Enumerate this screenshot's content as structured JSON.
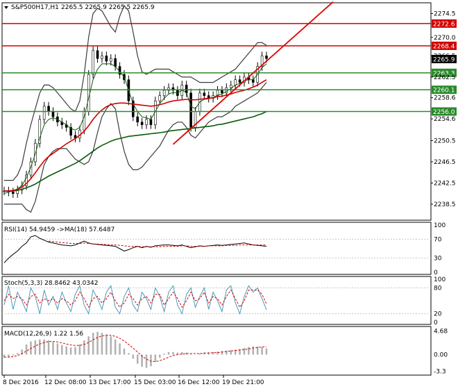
{
  "header": {
    "symbol": "S&P500H17,H1",
    "ohlc": "2265.5 2265.9 2265.5 2265.9"
  },
  "colors": {
    "bg": "#ffffff",
    "grid": "#c8c8c8",
    "candle": "#000000",
    "bollinger": "#3a3a3a",
    "ma_fast": "#0a5a0a",
    "ma_mid": "#d00000",
    "ma_slow": "#0a5a0a",
    "red_level": "#d00000",
    "green_level": "#2a8a2a",
    "trend": "#e00000",
    "rsi": "#000000",
    "rsi_ma": "#d00000",
    "stoch_main": "#4a9aba",
    "stoch_signal": "#d00000",
    "macd_hist": "#b0b0b0",
    "macd_signal": "#d00000"
  },
  "chart_data": [
    {
      "type": "line",
      "name": "price",
      "title": "S&P500H17,H1",
      "ylim": [
        2236.0,
        2276.0
      ],
      "y_ticks": [
        2274.5,
        2270.0,
        2266.5,
        2262.5,
        2258.6,
        2254.6,
        2250.5,
        2246.5,
        2242.5,
        2238.5
      ],
      "x_ticks": [
        "8 Dec 2016",
        "12 Dec 08:00",
        "13 Dec 17:00",
        "15 Dec 03:00",
        "16 Dec 12:00",
        "19 Dec 21:00"
      ],
      "current_price": 2265.9,
      "levels": [
        {
          "value": 2272.6,
          "label": "2272.6",
          "color": "red"
        },
        {
          "value": 2268.4,
          "label": "2268.4",
          "color": "red"
        },
        {
          "value": 2263.3,
          "label": "2263.3",
          "color": "green"
        },
        {
          "value": 2260.1,
          "label": "2260.1",
          "color": "green"
        },
        {
          "value": 2256.0,
          "label": "2256.0",
          "color": "green"
        }
      ],
      "close": [
        2241.0,
        2240.8,
        2240.5,
        2241.2,
        2242.0,
        2244.0,
        2246.5,
        2250.0,
        2254.5,
        2257.0,
        2256.0,
        2255.0,
        2254.0,
        2253.5,
        2253.0,
        2251.5,
        2251.0,
        2252.5,
        2256.0,
        2263.0,
        2267.5,
        2266.0,
        2266.5,
        2265.5,
        2266.0,
        2264.5,
        2263.0,
        2262.0,
        2258.0,
        2255.0,
        2254.0,
        2253.5,
        2254.5,
        2253.5,
        2258.0,
        2259.0,
        2260.0,
        2260.5,
        2260.0,
        2259.0,
        2261.0,
        2259.5,
        2253.0,
        2256.0,
        2259.5,
        2259.0,
        2258.5,
        2259.0,
        2260.0,
        2259.5,
        2260.5,
        2261.0,
        2262.0,
        2261.5,
        2262.5,
        2262.0,
        2261.5,
        2264.5,
        2266.5,
        2266.0
      ],
      "ma_fast": [
        2240.5,
        2240.8,
        2241.0,
        2241.4,
        2242.0,
        2243.5,
        2245.5,
        2248.0,
        2251.0,
        2253.5,
        2254.5,
        2254.8,
        2254.5,
        2254.0,
        2253.5,
        2252.8,
        2252.5,
        2253.0,
        2255.0,
        2258.5,
        2262.0,
        2264.0,
        2265.0,
        2265.0,
        2265.0,
        2264.5,
        2263.5,
        2262.5,
        2260.0,
        2257.5,
        2256.0,
        2255.0,
        2254.8,
        2254.5,
        2256.0,
        2257.5,
        2258.5,
        2259.3,
        2259.6,
        2259.5,
        2260.0,
        2259.6,
        2257.0,
        2256.5,
        2257.8,
        2258.3,
        2258.4,
        2258.6,
        2259.1,
        2259.3,
        2259.8,
        2260.3,
        2261.0,
        2261.3,
        2261.8,
        2262.0,
        2262.0,
        2263.0,
        2264.3,
        2265.0
      ],
      "ma_mid": [
        2241.0,
        2241.0,
        2241.1,
        2241.3,
        2241.7,
        2242.4,
        2243.3,
        2244.4,
        2245.6,
        2246.7,
        2247.5,
        2248.1,
        2248.7,
        2249.3,
        2249.9,
        2250.4,
        2250.9,
        2251.5,
        2252.3,
        2253.3,
        2254.5,
        2255.5,
        2256.3,
        2256.9,
        2257.3,
        2257.5,
        2257.6,
        2257.6,
        2257.5,
        2257.4,
        2257.3,
        2257.2,
        2257.1,
        2257.0,
        2257.1,
        2257.3,
        2257.5,
        2257.8,
        2258.0,
        2258.1,
        2258.2,
        2258.3,
        2258.2,
        2258.2,
        2258.3,
        2258.4,
        2258.5,
        2258.6,
        2258.8,
        2258.9,
        2259.1,
        2259.3,
        2259.6,
        2259.8,
        2260.0,
        2260.3,
        2260.6,
        2261.0,
        2261.5,
        2262.0
      ],
      "ma_slow": [
        2241.0,
        2241.0,
        2241.0,
        2241.1,
        2241.3,
        2241.6,
        2241.9,
        2242.3,
        2242.8,
        2243.3,
        2243.8,
        2244.2,
        2244.6,
        2245.0,
        2245.4,
        2245.8,
        2246.2,
        2246.7,
        2247.3,
        2247.9,
        2248.5,
        2249.1,
        2249.6,
        2250.0,
        2250.4,
        2250.7,
        2250.9,
        2251.1,
        2251.3,
        2251.4,
        2251.5,
        2251.6,
        2251.7,
        2251.8,
        2251.9,
        2252.0,
        2252.1,
        2252.3,
        2252.4,
        2252.5,
        2252.6,
        2252.7,
        2252.8,
        2252.9,
        2253.0,
        2253.1,
        2253.2,
        2253.3,
        2253.5,
        2253.6,
        2253.8,
        2254.0,
        2254.2,
        2254.4,
        2254.6,
        2254.8,
        2255.0,
        2255.3,
        2255.6,
        2256.0
      ],
      "boll_upper": [
        2243.0,
        2243.0,
        2243.0,
        2244.0,
        2246.0,
        2250.0,
        2253.5,
        2256.5,
        2259.5,
        2261.0,
        2261.0,
        2260.5,
        2259.5,
        2258.5,
        2257.5,
        2256.5,
        2256.0,
        2258.0,
        2263.0,
        2270.0,
        2274.5,
        2275.5,
        2275.0,
        2273.5,
        2272.0,
        2271.0,
        2274.0,
        2276.0,
        2275.0,
        2271.0,
        2266.5,
        2263.5,
        2263.0,
        2263.5,
        2264.0,
        2264.0,
        2264.0,
        2264.0,
        2263.5,
        2263.0,
        2262.5,
        2262.5,
        2262.5,
        2262.0,
        2261.5,
        2261.5,
        2261.5,
        2261.5,
        2262.0,
        2262.5,
        2263.0,
        2263.5,
        2264.0,
        2265.0,
        2266.0,
        2267.0,
        2268.0,
        2269.0,
        2269.0,
        2268.5
      ],
      "boll_lower": [
        2238.5,
        2238.5,
        2238.5,
        2238.5,
        2238.5,
        2237.5,
        2237.0,
        2239.0,
        2242.5,
        2246.0,
        2247.5,
        2248.5,
        2249.0,
        2249.0,
        2249.0,
        2248.0,
        2247.0,
        2246.5,
        2246.0,
        2246.5,
        2248.5,
        2252.0,
        2255.0,
        2256.5,
        2257.5,
        2256.5,
        2252.0,
        2248.5,
        2246.0,
        2245.0,
        2245.0,
        2245.5,
        2246.5,
        2247.5,
        2248.5,
        2249.5,
        2251.0,
        2252.5,
        2253.5,
        2254.0,
        2254.0,
        2253.0,
        2251.5,
        2251.0,
        2252.0,
        2253.0,
        2254.0,
        2254.5,
        2255.0,
        2255.0,
        2255.5,
        2256.0,
        2257.0,
        2257.5,
        2258.0,
        2258.5,
        2259.0,
        2259.5,
        2260.5,
        2261.5
      ],
      "trendline": {
        "from": [
          38,
          2249.8
        ],
        "to": [
          59,
          2265.5
        ]
      }
    },
    {
      "type": "line",
      "name": "rsi",
      "title": "RSI(14) 54.9459 ->MA(18) 57.6487",
      "ylim": [
        0,
        100
      ],
      "y_ticks": [
        100,
        70,
        30,
        0
      ],
      "values": [
        20,
        30,
        38,
        45,
        55,
        62,
        75,
        78,
        72,
        68,
        64,
        62,
        60,
        58,
        57,
        56,
        58,
        62,
        66,
        62,
        60,
        59,
        58,
        57,
        56,
        55,
        50,
        45,
        48,
        52,
        55,
        52,
        55,
        53,
        56,
        57,
        58,
        58,
        57,
        56,
        58,
        55,
        52,
        54,
        56,
        55,
        56,
        57,
        58,
        57,
        58,
        59,
        60,
        61,
        62,
        60,
        58,
        57,
        56,
        55
      ],
      "ma": [
        null,
        null,
        null,
        null,
        null,
        null,
        null,
        null,
        null,
        null,
        66,
        65,
        64,
        63,
        62,
        61,
        61,
        61,
        62,
        61,
        60,
        60,
        59,
        59,
        58,
        58,
        57,
        56,
        55,
        55,
        55,
        54,
        54,
        54,
        54,
        54,
        55,
        55,
        55,
        55,
        56,
        56,
        55,
        55,
        55,
        55,
        56,
        56,
        56,
        56,
        57,
        57,
        57,
        58,
        58,
        58,
        58,
        58,
        58,
        57.6
      ]
    },
    {
      "type": "line",
      "name": "stochastic",
      "title": "Stoch(5,3,3) 28.8462 43.0342",
      "ylim": [
        0,
        100
      ],
      "y_ticks": [
        100,
        80,
        20,
        0
      ],
      "main": [
        40,
        85,
        30,
        70,
        50,
        25,
        80,
        60,
        20,
        75,
        40,
        60,
        30,
        70,
        45,
        25,
        65,
        85,
        40,
        20,
        75,
        55,
        30,
        70,
        85,
        35,
        20,
        60,
        80,
        40,
        25,
        70,
        55,
        30,
        80,
        60,
        25,
        70,
        85,
        40,
        20,
        65,
        80,
        35,
        60,
        80,
        30,
        70,
        50,
        25,
        75,
        85,
        45,
        20,
        60,
        85,
        70,
        80,
        55,
        28.8
      ],
      "signal": [
        50,
        65,
        55,
        60,
        55,
        40,
        60,
        65,
        45,
        55,
        50,
        55,
        45,
        55,
        50,
        40,
        50,
        70,
        55,
        35,
        55,
        60,
        45,
        55,
        70,
        50,
        35,
        45,
        65,
        55,
        40,
        55,
        60,
        45,
        65,
        65,
        40,
        55,
        70,
        55,
        35,
        50,
        70,
        50,
        55,
        70,
        45,
        60,
        55,
        40,
        60,
        75,
        55,
        35,
        50,
        75,
        75,
        75,
        65,
        43.0
      ]
    },
    {
      "type": "bar",
      "name": "macd",
      "title": "MACD(12,26,9) 1.22 1.56",
      "ylim": [
        -3.5,
        5.0
      ],
      "y_ticks": [
        4.68,
        0.0,
        -3.3
      ],
      "hist": [
        -0.6,
        -0.5,
        -0.2,
        0.3,
        1.0,
        2.0,
        2.6,
        2.8,
        3.0,
        3.0,
        2.8,
        2.5,
        2.2,
        1.9,
        1.6,
        1.4,
        1.5,
        2.0,
        2.8,
        3.6,
        4.3,
        4.5,
        4.3,
        4.0,
        3.6,
        3.0,
        2.2,
        1.2,
        0.3,
        -0.8,
        -1.8,
        -2.4,
        -2.6,
        -2.3,
        -1.4,
        -0.6,
        0.2,
        0.5,
        0.5,
        0.4,
        0.5,
        0.4,
        0.1,
        0.0,
        0.2,
        0.4,
        0.5,
        0.5,
        0.6,
        0.7,
        0.8,
        0.9,
        1.0,
        1.1,
        1.3,
        1.5,
        1.6,
        1.6,
        1.5,
        1.22
      ],
      "signal": [
        -0.5,
        -0.5,
        -0.4,
        -0.2,
        0.2,
        0.7,
        1.2,
        1.7,
        2.1,
        2.4,
        2.6,
        2.6,
        2.5,
        2.3,
        2.1,
        1.9,
        1.8,
        1.8,
        2.0,
        2.4,
        2.9,
        3.4,
        3.7,
        3.8,
        3.8,
        3.6,
        3.2,
        2.7,
        2.0,
        1.3,
        0.5,
        -0.3,
        -0.9,
        -1.3,
        -1.4,
        -1.2,
        -0.9,
        -0.5,
        -0.2,
        0.0,
        0.1,
        0.2,
        0.2,
        0.2,
        0.2,
        0.3,
        0.3,
        0.4,
        0.4,
        0.5,
        0.6,
        0.7,
        0.8,
        0.9,
        1.0,
        1.1,
        1.3,
        1.4,
        1.5,
        1.56
      ]
    }
  ]
}
